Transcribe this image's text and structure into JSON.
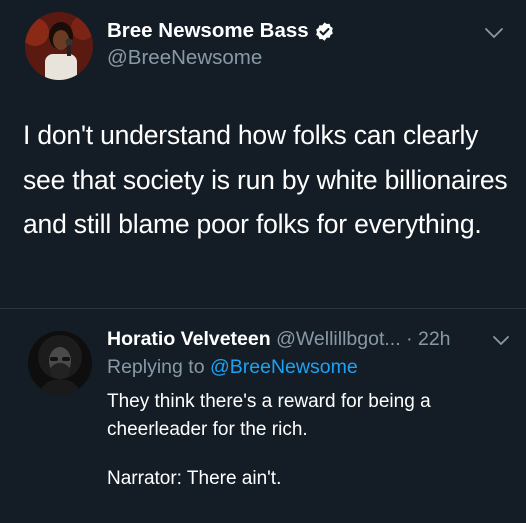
{
  "tweet": {
    "author_name": "Bree Newsome Bass",
    "author_handle": "@BreeNewsome",
    "text": "I don't understand how folks can clearly see that society is run by white billionaires and still blame poor folks for everything."
  },
  "reply": {
    "author_name": "Horatio Velveteen",
    "author_handle": "@Wellillbgot...",
    "separator": "·",
    "time": "22h",
    "replying_to_label": "Replying to",
    "replying_to_handle": "@BreeNewsome",
    "text_line1": "They think there's a reward for being a cheerleader for the rich.",
    "text_line2": "Narrator: There ain't."
  },
  "colors": {
    "background": "#141d26",
    "secondary_text": "#8899a6",
    "link": "#1da1f2",
    "verified_badge": "#ffffff"
  },
  "icons": {
    "verified": "verified-badge-icon",
    "menu": "chevron-down-icon"
  }
}
